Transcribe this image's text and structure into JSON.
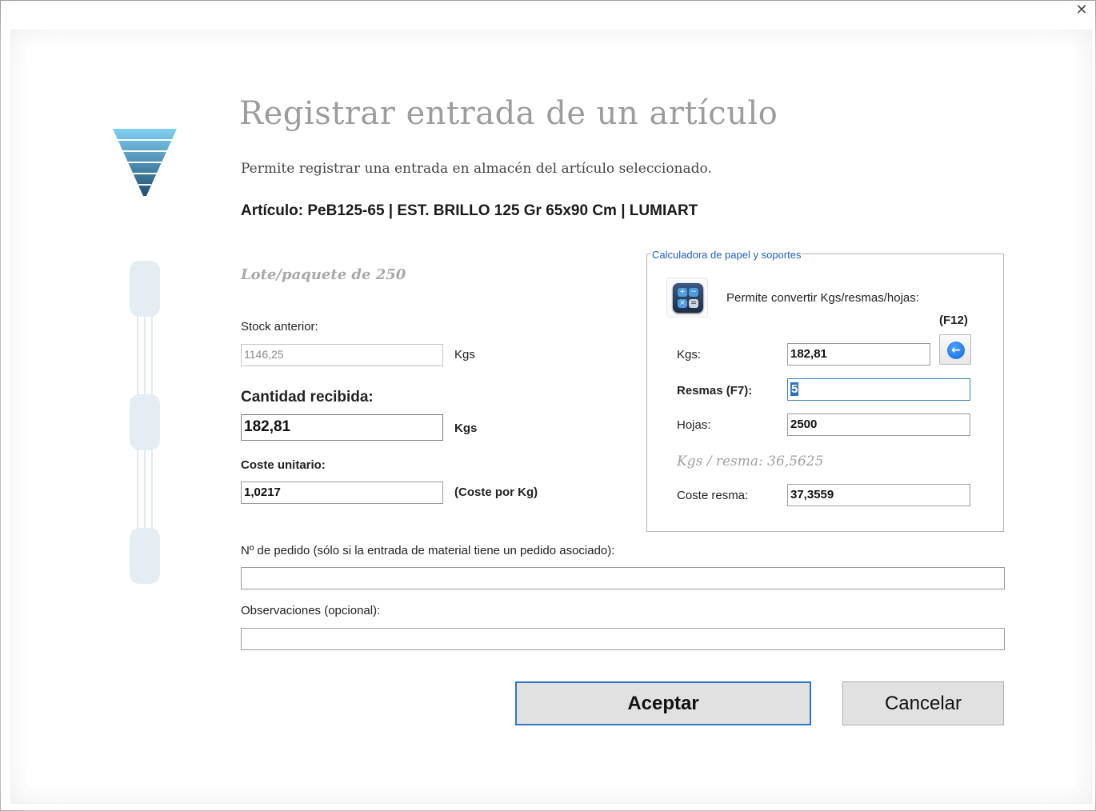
{
  "window": {
    "close_glyph": "✕"
  },
  "header": {
    "title": "Registrar entrada de un artículo",
    "subtitle": "Permite registrar una entrada en almacén del artículo seleccionado.",
    "article": "Artículo: PeB125-65  |  EST. BRILLO 125 Gr 65x90 Cm  |  LUMIART"
  },
  "form": {
    "lote": "Lote/paquete de 250",
    "stock_label": "Stock anterior:",
    "stock_value": "1146,25",
    "stock_unit": "Kgs",
    "cantidad_label": "Cantidad recibida:",
    "cantidad_value": "182,81",
    "cantidad_unit": "Kgs",
    "coste_label": "Coste unitario:",
    "coste_value": "1,0217",
    "coste_unit": "(Coste por Kg)",
    "pedido_label": "Nº de pedido (sólo si la entrada de material tiene un pedido asociado):",
    "pedido_value": "",
    "observ_label": "Observaciones (opcional):",
    "observ_value": ""
  },
  "calculator": {
    "legend": "Calculadora de papel y soportes",
    "description": "Permite convertir Kgs/resmas/hojas:",
    "shortcut": "(F12)",
    "kgs_label": "Kgs:",
    "kgs_value": "182,81",
    "resmas_label": "Resmas (F7):",
    "resmas_value": "5",
    "hojas_label": "Hojas:",
    "hojas_value": "2500",
    "kgs_resma": "Kgs / resma:  36,5625",
    "coste_resma_label": "Coste resma:",
    "coste_resma_value": "37,3559",
    "icon": "calculator-icon",
    "arrow_icon": "arrow-left-icon"
  },
  "actions": {
    "accept": "Aceptar",
    "cancel": "Cancelar"
  },
  "colors": {
    "accent": "#2b76c9",
    "legend": "#1f5fbd",
    "title_gray": "#9c9c9c"
  }
}
